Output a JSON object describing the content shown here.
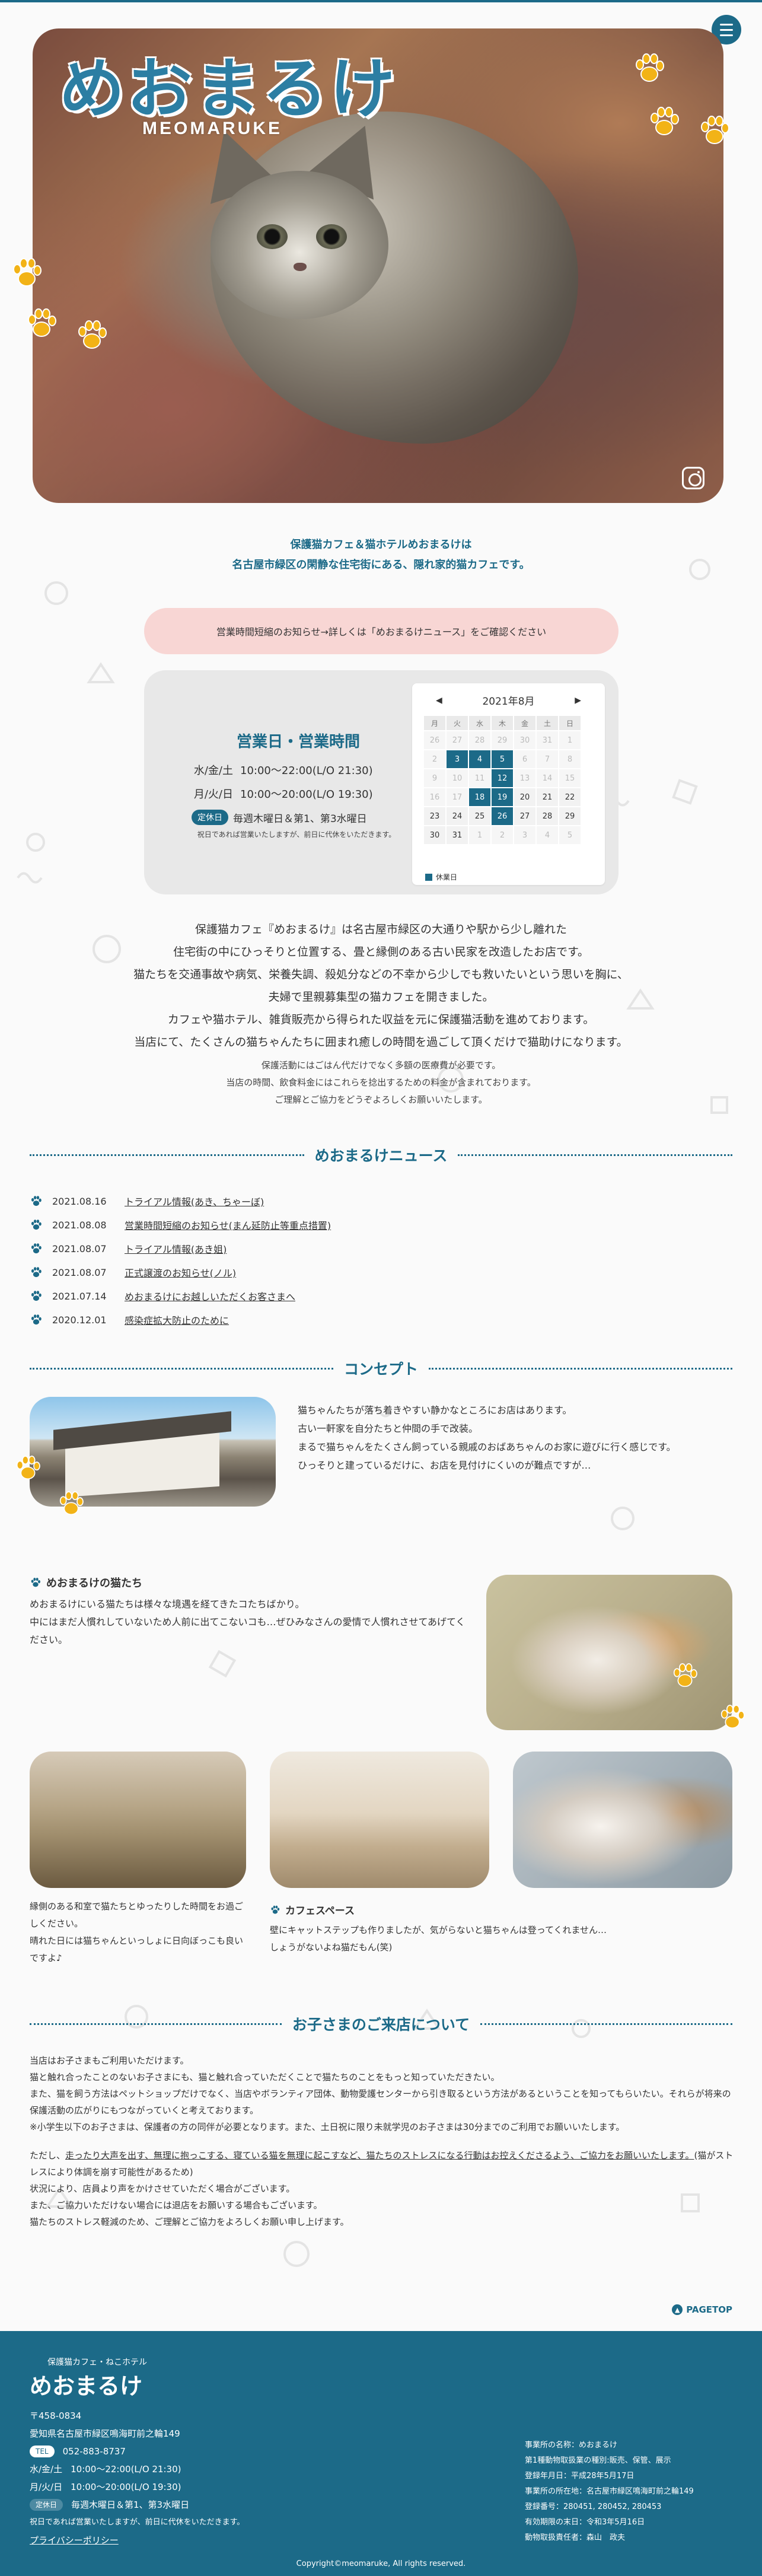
{
  "colors": {
    "accent": "#1c6a88",
    "notice_bg": "#f8d6d4",
    "paw": "#f2b317"
  },
  "hero": {
    "logo": "めおまるけ",
    "logo_sub": "MEOMARUKE",
    "instagram_icon": "instagram-icon",
    "menu_icon": "hamburger-icon"
  },
  "intro": {
    "line1": "保護猫カフェ＆猫ホテルめおまるけは",
    "line2": "名古屋市緑区の閑静な住宅街にある、隠れ家的猫カフェです。"
  },
  "notice": "営業時間短縮のお知らせ→詳しくは「めおまるけニュース」をご確認ください",
  "hours": {
    "title": "営業日・営業時間",
    "rows": [
      {
        "days": "水/金/土",
        "time": "10:00～22:00(L/O 21:30)"
      },
      {
        "days": "月/火/日",
        "time": "10:00～20:00(L/O 19:30)"
      }
    ],
    "closed_label": "定休日",
    "closed_text": "毎週木曜日＆第1、第3水曜日",
    "closed_note": "祝日であれば営業いたしますが、前日に代休をいただきます。"
  },
  "calendar": {
    "month": "2021年8月",
    "prev": "◀",
    "next": "▶",
    "weekdays": [
      "月",
      "火",
      "水",
      "木",
      "金",
      "土",
      "日"
    ],
    "weeks": [
      [
        {
          "d": "26",
          "m": true
        },
        {
          "d": "27",
          "m": true
        },
        {
          "d": "28",
          "m": true
        },
        {
          "d": "29",
          "m": true
        },
        {
          "d": "30",
          "m": true
        },
        {
          "d": "31",
          "m": true
        },
        {
          "d": "1",
          "m": true
        }
      ],
      [
        {
          "d": "2",
          "m": true
        },
        {
          "d": "3",
          "off": true
        },
        {
          "d": "4",
          "off": true
        },
        {
          "d": "5",
          "off": true
        },
        {
          "d": "6",
          "m": true
        },
        {
          "d": "7",
          "m": true
        },
        {
          "d": "8",
          "m": true
        }
      ],
      [
        {
          "d": "9",
          "m": true
        },
        {
          "d": "10",
          "m": true
        },
        {
          "d": "11",
          "m": true
        },
        {
          "d": "12",
          "off": true
        },
        {
          "d": "13",
          "m": true
        },
        {
          "d": "14",
          "m": true
        },
        {
          "d": "15",
          "m": true
        }
      ],
      [
        {
          "d": "16",
          "m": true
        },
        {
          "d": "17",
          "m": true
        },
        {
          "d": "18",
          "off": true
        },
        {
          "d": "19",
          "off": true
        },
        {
          "d": "20"
        },
        {
          "d": "21"
        },
        {
          "d": "22"
        }
      ],
      [
        {
          "d": "23"
        },
        {
          "d": "24"
        },
        {
          "d": "25"
        },
        {
          "d": "26",
          "off": true,
          "today": true
        },
        {
          "d": "27"
        },
        {
          "d": "28"
        },
        {
          "d": "29"
        }
      ],
      [
        {
          "d": "30"
        },
        {
          "d": "31"
        },
        {
          "d": "1",
          "m": true
        },
        {
          "d": "2",
          "m": true
        },
        {
          "d": "3",
          "m": true
        },
        {
          "d": "4",
          "m": true
        },
        {
          "d": "5",
          "m": true
        }
      ]
    ],
    "legend": "休業日"
  },
  "about": {
    "lines": [
      "保護猫カフェ『めおまるけ』は名古屋市緑区の大通りや駅から少し離れた",
      "住宅街の中にひっそりと位置する、畳と縁側のある古い民家を改造したお店です。",
      "猫たちを交通事故や病気、栄養失調、殺処分などの不幸から少しでも救いたいという思いを胸に、",
      "夫婦で里親募集型の猫カフェを開きました。",
      "カフェや猫ホテル、雑貨販売から得られた収益を元に保護猫活動を進めております。",
      "当店にて、たくさんの猫ちゃんたちに囲まれ癒しの時間を過ごして頂くだけで猫助けになります。"
    ],
    "small": [
      "保護活動にはごはん代だけでなく多額の医療費が必要です。",
      "当店の時間、飲食料金にはこれらを捻出するための料金が含まれております。",
      "ご理解とご協力をどうぞよろしくお願いいたします。"
    ]
  },
  "news": {
    "title": "めおまるけニュース",
    "items": [
      {
        "date": "2021.08.16",
        "title": "トライアル情報(あき、ちゃーぼ)"
      },
      {
        "date": "2021.08.08",
        "title": "営業時間短縮のお知らせ(まん延防止等重点措置)"
      },
      {
        "date": "2021.08.07",
        "title": "トライアル情報(あき姐)"
      },
      {
        "date": "2021.08.07",
        "title": "正式譲渡のお知らせ(ノル)"
      },
      {
        "date": "2021.07.14",
        "title": "めおまるけにお越しいただくお客さまへ"
      },
      {
        "date": "2020.12.01",
        "title": "感染症拡大防止のために"
      }
    ]
  },
  "concept": {
    "title": "コンセプト",
    "lines": [
      "猫ちゃんたちが落ち着きやすい静かなところにお店はあります。",
      "古い一軒家を自分たちと仲間の手で改装。",
      "まるで猫ちゃんをたくさん飼っている親戚のおばあちゃんのお家に遊びに行く感じです。",
      "ひっそりと建っているだけに、お店を見付けにくいのが難点ですが…"
    ],
    "cats_title": "めおまるけの猫たち",
    "cats_lines": [
      "めおまるけにいる猫たちは様々な境遇を経てきたコたちばかり。",
      "中にはまだ人慣れしていないため人前に出てこないコも…ぜひみなさんの愛情で人慣れさせてあげてください。"
    ],
    "caption1": [
      "縁側のある和室で猫たちとゆったりした時間をお過ごしください。",
      "晴れた日には猫ちゃんといっしょに日向ぼっこも良いですよ♪"
    ],
    "cafe_title": "カフェスペース",
    "cafe_lines": [
      "壁にキャットステップも作りましたが、気がらないと猫ちゃんは登ってくれません…",
      "しょうがないよね猫だもん(笑)"
    ]
  },
  "kids": {
    "title": "お子さまのご来店について",
    "p1": [
      "当店はお子さまもご利用いただけます。",
      "猫と触れ合ったことのないお子さまにも、猫と触れ合っていただくことで猫たちのことをもっと知っていただきたい。",
      "また、猫を飼う方法はペットショップだけでなく、当店やボランティア団体、動物愛護センターから引き取るという方法があるということを知ってもらいたい。それらが将来の保護活動の広がりにもつながっていくと考えております。",
      "※小学生以下のお子さまは、保護者の方の同伴が必要となります。また、土日祝に限り未就学児のお子さまは30分までのご利用でお願いいたします。"
    ],
    "p2_a": "ただし、",
    "p2_u1": "走ったり大声を出す、無理に抱っこする、寝ている猫を無理に起こすなど、猫たちのストレスになる行動はお控えくださるよう、ご協力をお願いいたします。",
    "p2_b": "(猫がストレスにより体調を崩す可能性があるため)",
    "p3": [
      "状況により、店員より声をかけさせていただく場合がございます。",
      "また、ご協力いただけない場合には退店をお願いする場合もございます。",
      "猫たちのストレス軽減のため、ご理解とご協力をよろしくお願い申し上げます。"
    ]
  },
  "pagetop": "PAGETOP",
  "footer": {
    "sub": "保護猫カフェ・ねこホテル",
    "logo": "めおまるけ",
    "postal": "〒458-0834",
    "address": "愛知県名古屋市緑区鳴海町前之輪149",
    "tel_label": "TEL",
    "tel": "052-883-8737",
    "hours": [
      {
        "days": "水/金/土",
        "time": "10:00～22:00(L/O 21:30)"
      },
      {
        "days": "月/火/日",
        "time": "10:00～20:00(L/O 19:30)"
      }
    ],
    "closed_label": "定休日",
    "closed_text": "毎週木曜日＆第1、第3水曜日",
    "closed_note": "祝日であれば営業いたしますが、前日に代休をいただきます。",
    "privacy": "プライバシーポリシー",
    "legal": [
      "事業所の名称：めおまるけ",
      "第1種動物取扱業の種別:販売、保管、展示",
      "登録年月日：平成28年5月17日",
      "事業所の所在地：名古屋市緑区鳴海町前之輪149",
      "登録番号：280451, 280452, 280453",
      "有効期限の末日：令和3年5月16日",
      "動物取扱責任者：森山　政夫"
    ],
    "copyright": "Copyright©meomaruke, All rights reserved."
  }
}
